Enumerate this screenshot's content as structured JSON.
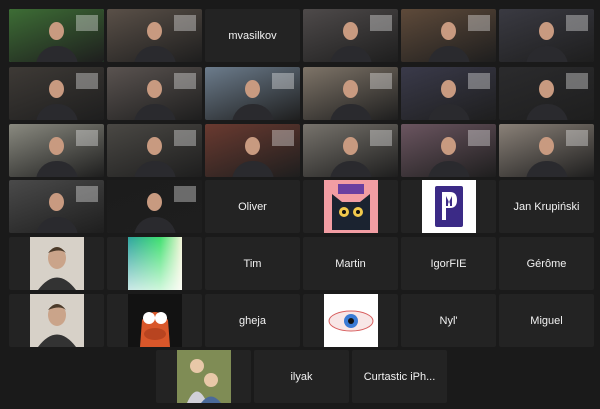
{
  "participants": [
    {
      "id": "p1",
      "kind": "video",
      "name": "",
      "speaking": true,
      "tint": "#3d6d35"
    },
    {
      "id": "p2",
      "kind": "video",
      "name": "",
      "tint": "#5a5048"
    },
    {
      "id": "p3",
      "kind": "name",
      "name": "mvasilkov"
    },
    {
      "id": "p4",
      "kind": "video",
      "name": "",
      "tint": "#4e4a4a"
    },
    {
      "id": "p5",
      "kind": "video",
      "name": "",
      "tint": "#5e4a3a"
    },
    {
      "id": "p6",
      "kind": "video",
      "name": "",
      "tint": "#3a3a42"
    },
    {
      "id": "p7",
      "kind": "video",
      "name": "",
      "tint": "#3e3a36"
    },
    {
      "id": "p8",
      "kind": "video",
      "name": "",
      "tint": "#5a5350"
    },
    {
      "id": "p9",
      "kind": "video",
      "name": "",
      "tint": "#6c7c8c"
    },
    {
      "id": "p10",
      "kind": "video",
      "name": "",
      "tint": "#7e7468"
    },
    {
      "id": "p11",
      "kind": "video",
      "name": "",
      "tint": "#3a3a4a"
    },
    {
      "id": "p12",
      "kind": "video",
      "name": "",
      "tint": "#2b2b2d"
    },
    {
      "id": "p13",
      "kind": "video",
      "name": "",
      "tint": "#8a8a80"
    },
    {
      "id": "p14",
      "kind": "video",
      "name": "",
      "tint": "#4a4844"
    },
    {
      "id": "p15",
      "kind": "video",
      "name": "",
      "tint": "#6a3a30"
    },
    {
      "id": "p16",
      "kind": "video",
      "name": "",
      "tint": "#77736c"
    },
    {
      "id": "p17",
      "kind": "video",
      "name": "",
      "tint": "#6b5560"
    },
    {
      "id": "p18",
      "kind": "video",
      "name": "",
      "tint": "#8a8178"
    },
    {
      "id": "p19",
      "kind": "video",
      "name": "",
      "tint": "#4a4a4a"
    },
    {
      "id": "p20",
      "kind": "video",
      "name": "",
      "tint": "#1c1c1c"
    },
    {
      "id": "p21",
      "kind": "name",
      "name": "Oliver"
    },
    {
      "id": "p22",
      "kind": "avatar",
      "avatar": "cat",
      "name": ""
    },
    {
      "id": "p23",
      "kind": "avatar",
      "avatar": "pm",
      "name": ""
    },
    {
      "id": "p24",
      "kind": "name",
      "name": "Jan Krupiński"
    },
    {
      "id": "p25",
      "kind": "avatar",
      "avatar": "person",
      "name": ""
    },
    {
      "id": "p26",
      "kind": "avatar",
      "avatar": "gradient",
      "name": ""
    },
    {
      "id": "p27",
      "kind": "name",
      "name": "Tim"
    },
    {
      "id": "p28",
      "kind": "name",
      "name": "Martin"
    },
    {
      "id": "p29",
      "kind": "name",
      "name": "IgorFIE"
    },
    {
      "id": "p30",
      "kind": "name",
      "name": "Gérôme"
    },
    {
      "id": "p31",
      "kind": "avatar",
      "avatar": "person",
      "name": ""
    },
    {
      "id": "p32",
      "kind": "avatar",
      "avatar": "muppet",
      "name": ""
    },
    {
      "id": "p33",
      "kind": "name",
      "name": "gheja"
    },
    {
      "id": "p34",
      "kind": "avatar",
      "avatar": "eye",
      "name": ""
    },
    {
      "id": "p35",
      "kind": "name",
      "name": "Nyl'"
    },
    {
      "id": "p36",
      "kind": "name",
      "name": "Miguel"
    },
    {
      "id": "p37",
      "kind": "avatar",
      "avatar": "kids",
      "name": ""
    },
    {
      "id": "p38",
      "kind": "name",
      "name": "ilyak"
    },
    {
      "id": "p39",
      "kind": "name",
      "name": "Curtastic iPh..."
    }
  ],
  "colors": {
    "background": "#1a1a1a",
    "tile": "#232323",
    "speaking_border": "#3fd15a",
    "name_text": "#f2f2f2"
  }
}
